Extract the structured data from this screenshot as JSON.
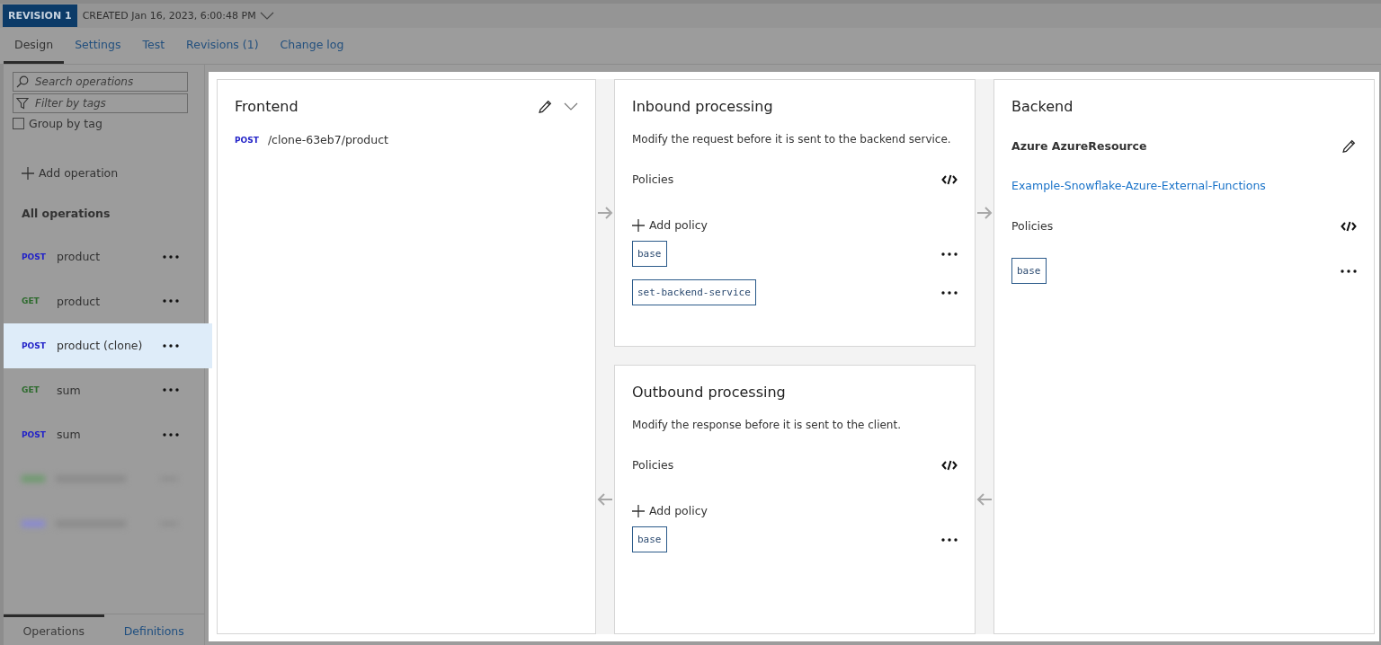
{
  "revision": {
    "badge": "REVISION 1",
    "created": "CREATED Jan 16, 2023, 6:00:48 PM"
  },
  "tabs": [
    {
      "label": "Design",
      "selected": true
    },
    {
      "label": "Settings",
      "selected": false
    },
    {
      "label": "Test",
      "selected": false
    },
    {
      "label": "Revisions (1)",
      "selected": false
    },
    {
      "label": "Change log",
      "selected": false
    }
  ],
  "sidebar": {
    "search": {
      "placeholder": "Search operations"
    },
    "filter": {
      "placeholder": "Filter by tags"
    },
    "group_by_tag": {
      "label": "Group by tag",
      "checked": false
    },
    "add_operation": "Add operation",
    "heading": "All operations",
    "operations": [
      {
        "kind": "operation",
        "method": "POST",
        "name": "product",
        "selected": false
      },
      {
        "kind": "operation",
        "method": "GET",
        "name": "product",
        "selected": false
      },
      {
        "kind": "operation",
        "method": "POST",
        "name": "product (clone)",
        "selected": true
      },
      {
        "kind": "operation",
        "method": "GET",
        "name": "sum",
        "selected": false
      },
      {
        "kind": "operation",
        "method": "POST",
        "name": "sum",
        "selected": false
      },
      {
        "kind": "blurred",
        "color": "#6f9a6f",
        "selected": false
      },
      {
        "kind": "blurred",
        "color": "#8a8ad0",
        "selected": false
      }
    ],
    "bottom_tabs": [
      {
        "label": "Operations",
        "selected": true
      },
      {
        "label": "Definitions",
        "selected": false
      }
    ]
  },
  "frontend": {
    "title": "Frontend",
    "method": "POST",
    "path": "/clone-63eb7/product"
  },
  "inbound": {
    "title": "Inbound processing",
    "description": "Modify the request before it is sent to the backend service.",
    "policies_label": "Policies",
    "add_policy": "Add policy",
    "policies": [
      "base",
      "set-backend-service"
    ]
  },
  "outbound": {
    "title": "Outbound processing",
    "description": "Modify the response before it is sent to the client.",
    "policies_label": "Policies",
    "add_policy": "Add policy",
    "policies": [
      "base"
    ]
  },
  "backend": {
    "title": "Backend",
    "service": "Azure AzureResource",
    "link": "Example-Snowflake-Azure-External-Functions",
    "policies_label": "Policies",
    "policies": [
      "base"
    ]
  }
}
